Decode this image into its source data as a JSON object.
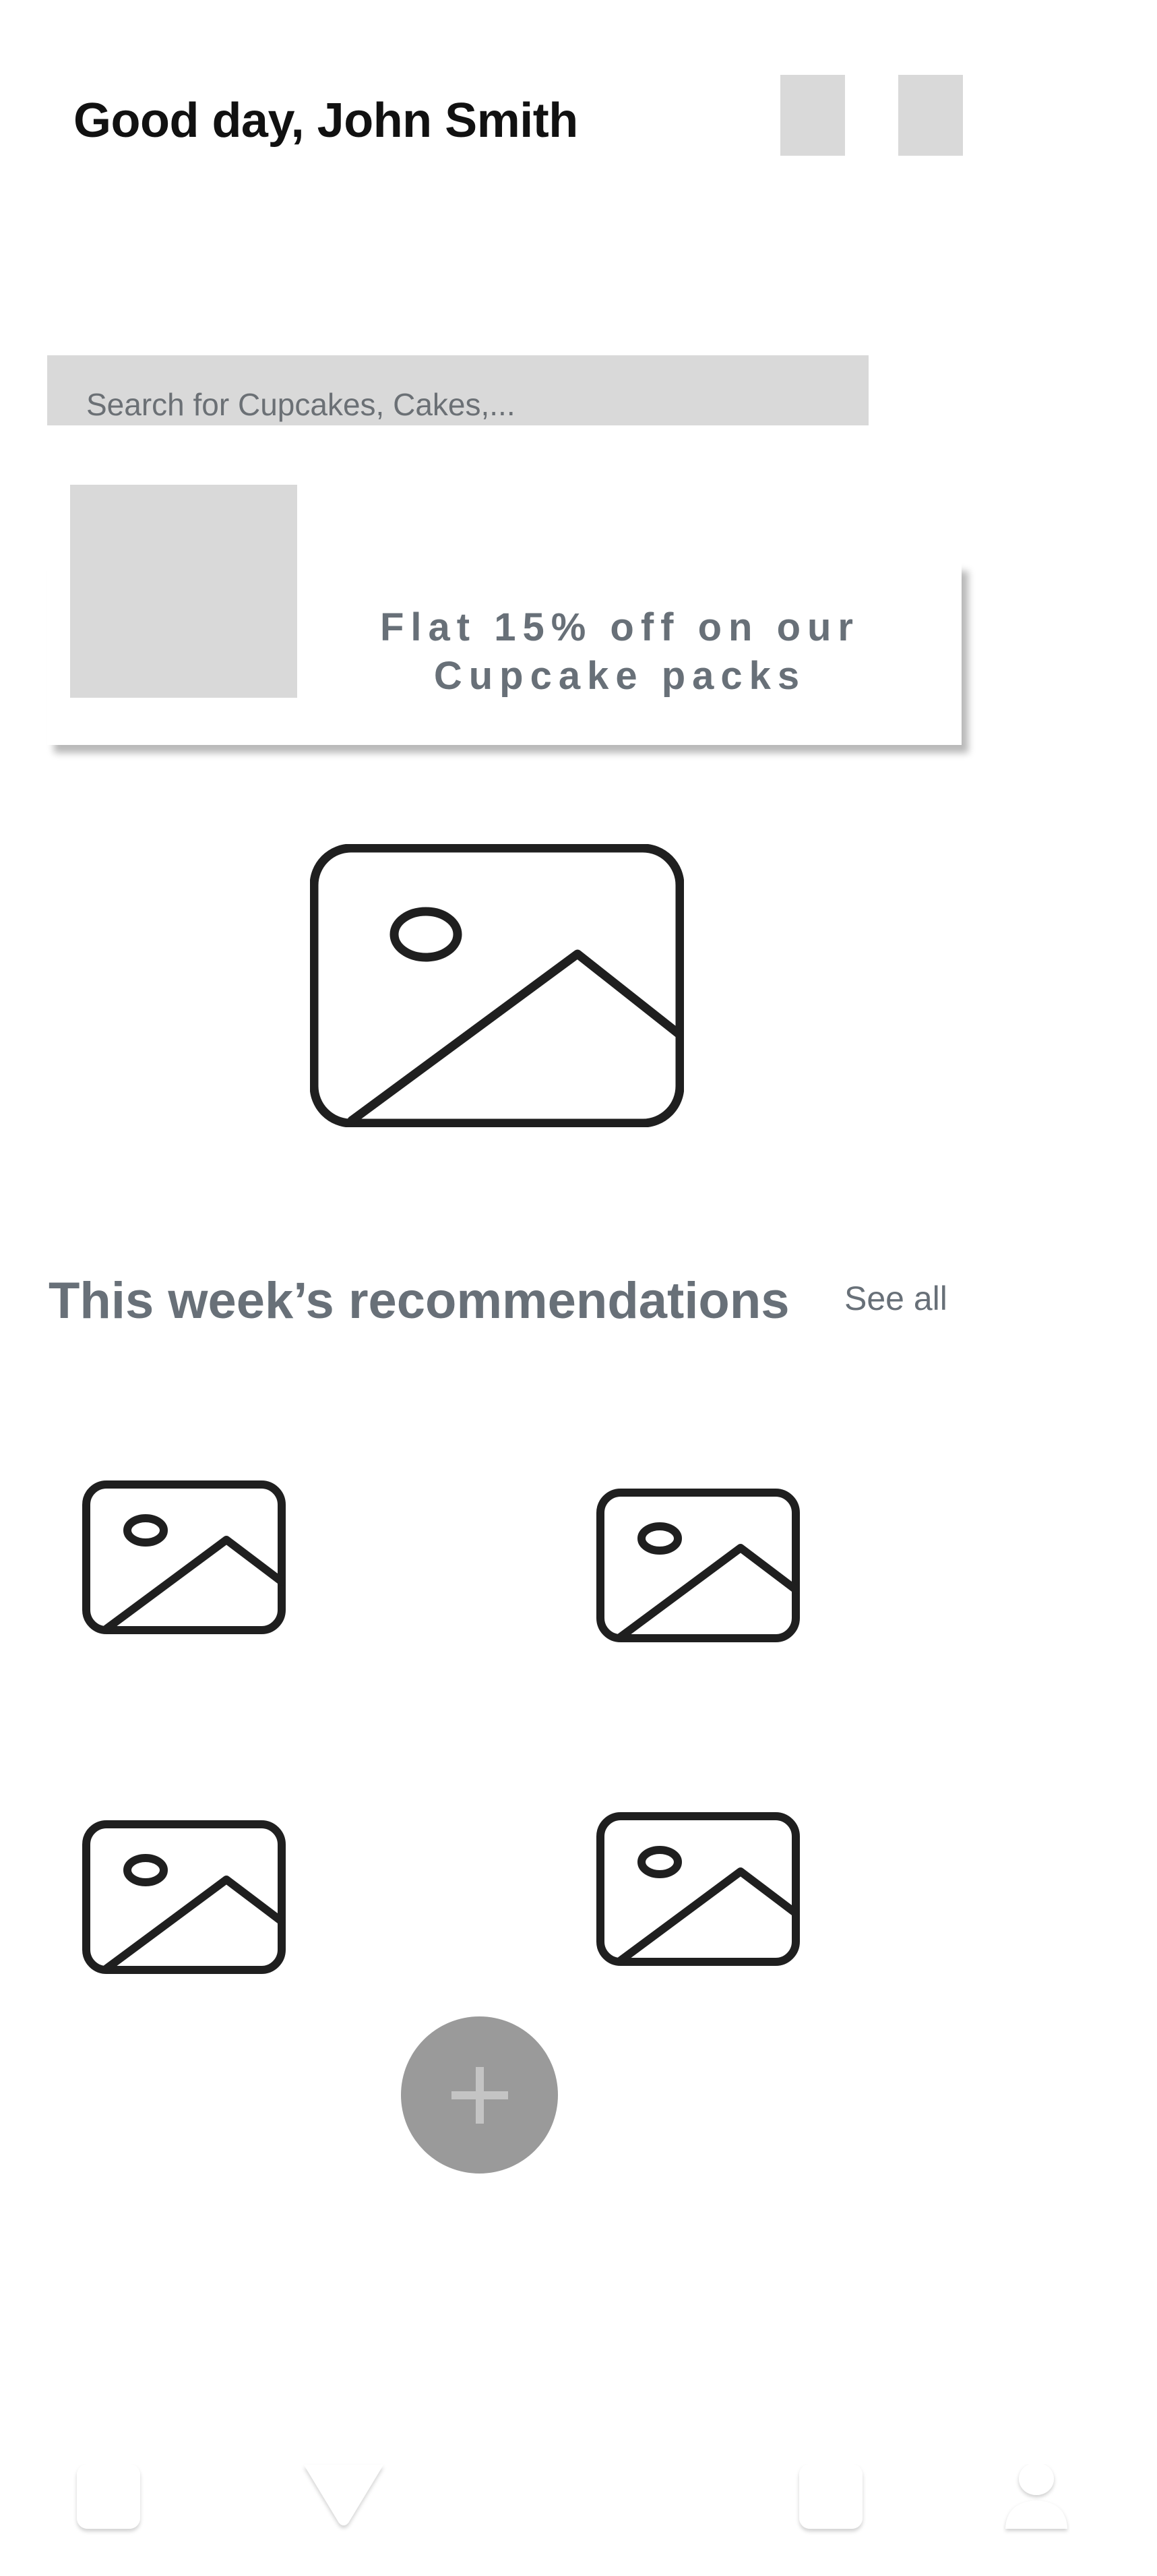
{
  "header": {
    "greeting": "Good day, John Smith"
  },
  "search": {
    "placeholder": "Search for Cupcakes, Cakes,..."
  },
  "promo": {
    "line1": "Flat 15% off on our",
    "line2": "Cupcake packs"
  },
  "recommendations": {
    "title": "This week’s recommendations",
    "see_all": "See all"
  },
  "icons": {
    "hero": "image-placeholder-icon",
    "items": [
      "image-placeholder-icon",
      "image-placeholder-icon",
      "image-placeholder-icon",
      "image-placeholder-icon"
    ],
    "fab": "plus-icon",
    "nav": [
      "home-tab-icon",
      "chevron-down-icon",
      "cart-tab-icon",
      "profile-icon"
    ]
  },
  "colors": {
    "placeholder_gray": "#d9d9d9",
    "muted_text": "#687078",
    "fab": "#9a9a9a",
    "icon_stroke": "#1f1f1f"
  }
}
